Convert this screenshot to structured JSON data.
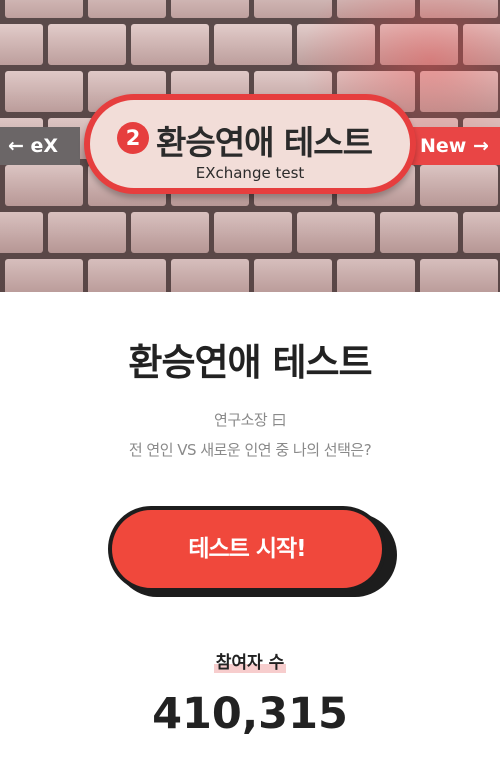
{
  "hero": {
    "left_label": "← eX",
    "right_label": "New →",
    "badge_number": "2",
    "sign_title": "환승연애 테스트",
    "sign_subtitle": "EXchange test",
    "colors": {
      "accent": "#e63e3e",
      "sign_fill": "#f2ddd8",
      "brick": "#c8a9a7"
    }
  },
  "main": {
    "title": "환승연애 테스트",
    "description_line1": "연구소장 曰",
    "description_line2": "전 연인 VS 새로운 인연 중 나의 선택은?",
    "start_button": "테스트 시작!",
    "participants_label": "참여자 수",
    "participants_count": "410,315"
  }
}
